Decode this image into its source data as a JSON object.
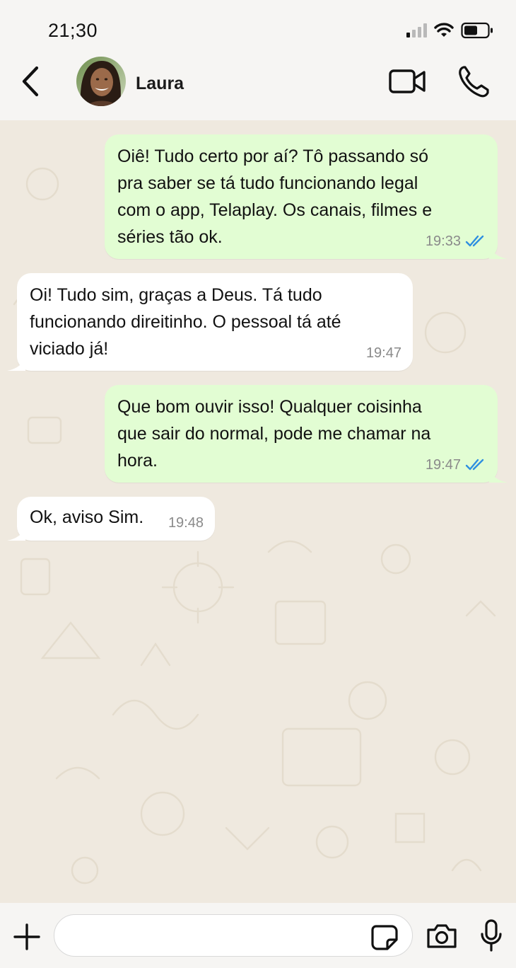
{
  "status_bar": {
    "time": "21;30",
    "icons": [
      "signal-icon",
      "wifi-icon",
      "battery-icon"
    ]
  },
  "header": {
    "contact_name": "Laura",
    "icons": [
      "back-arrow-icon",
      "video-camera-icon",
      "phone-icon"
    ]
  },
  "messages": [
    {
      "direction": "out",
      "text": "Oiê! Tudo certo por aí? Tô passando só\npra saber se tá tudo funcionando legal\ncom o app,  Telaplay. Os canais, filmes e\nséries tão ok.",
      "time": "19:33",
      "read": true
    },
    {
      "direction": "in",
      "text": "Oi! Tudo sim, graças a Deus. Tá tudo\nfuncionando direitinho. O pessoal tá até\nviciado já!",
      "time": "19:47"
    },
    {
      "direction": "out",
      "text": "Que bom ouvir isso! Qualquer coisinha\nque sair do normal, pode me chamar na\nhora.",
      "time": "19:47",
      "read": true
    },
    {
      "direction": "in",
      "text": "Ok, aviso Sim.",
      "time": "19:48"
    }
  ],
  "input_bar": {
    "message_value": "",
    "icons": [
      "plus-icon",
      "sticker-icon",
      "camera-icon",
      "microphone-icon"
    ]
  },
  "colors": {
    "outgoing_bubble": "#e2fdd3",
    "incoming_bubble": "#ffffff",
    "read_ticks": "#2f8fe0",
    "chat_background": "#efe9df"
  }
}
